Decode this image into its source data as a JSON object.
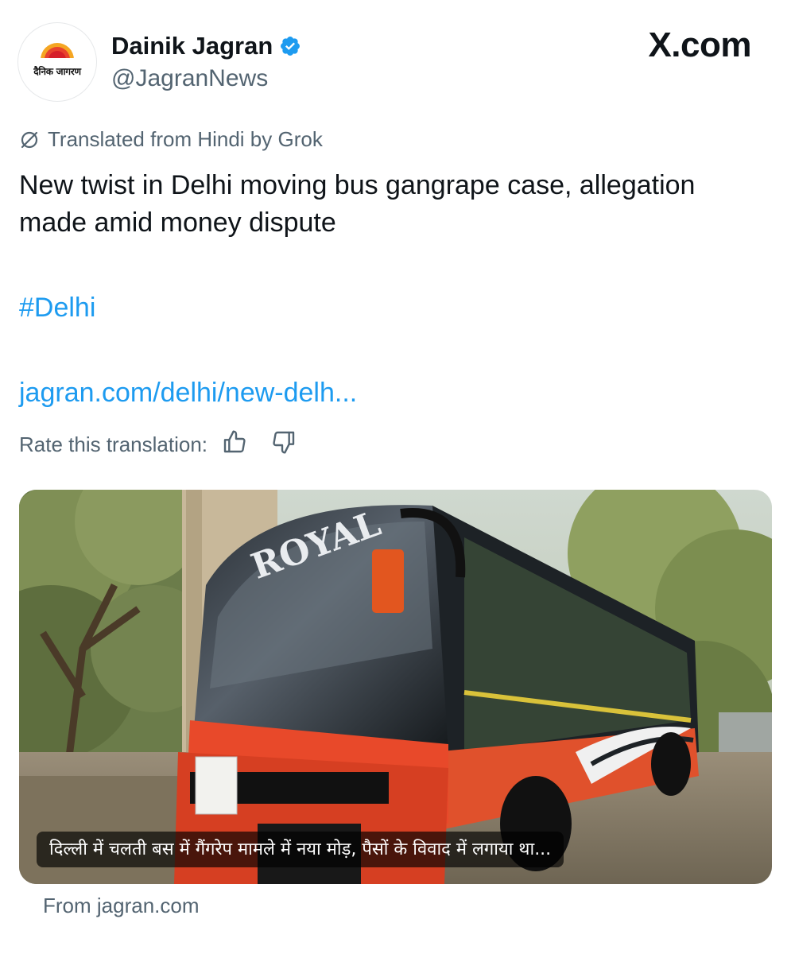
{
  "author": {
    "name": "Dainik Jagran",
    "handle": "@JagranNews",
    "avatar_text": "दैनिक जागरण",
    "verified": true
  },
  "brand": "X.com",
  "translation": {
    "note": "Translated from Hindi by Grok",
    "rate_label": "Rate this translation:"
  },
  "post": {
    "text": "New twist in Delhi moving bus gangrape case, allegation made amid money dispute",
    "hashtag": "#Delhi",
    "link": "jagran.com/delhi/new-delh..."
  },
  "card": {
    "caption": "दिल्ली में चलती बस में गैंगरेप मामले में नया मोड़, पैसों के विवाद में लगाया था...",
    "bus_text": "ROYAL",
    "source": "From jagran.com"
  },
  "colors": {
    "link": "#1d9bf0",
    "secondary_text": "#536471",
    "verified_badge": "#1d9bf0"
  },
  "icons": [
    "grok-icon",
    "verified-badge-icon",
    "thumbs-up-icon",
    "thumbs-down-icon"
  ]
}
